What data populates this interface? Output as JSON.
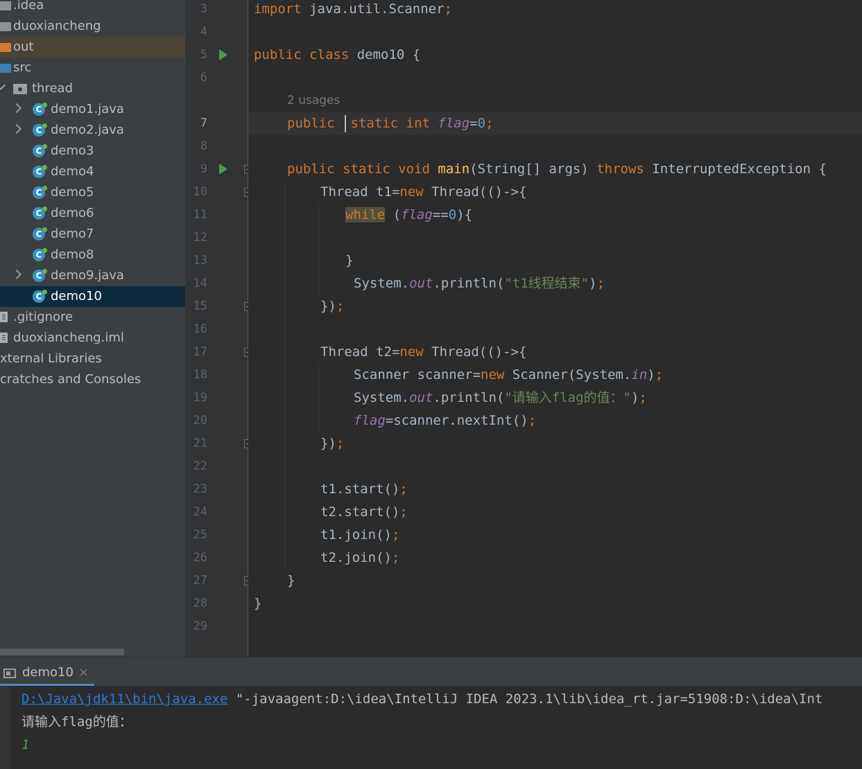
{
  "project_tree": {
    "items": [
      {
        "label": ".idea"
      },
      {
        "label": "duoxiancheng"
      },
      {
        "label": "out"
      },
      {
        "label": "src"
      },
      {
        "label": "thread"
      },
      {
        "label": "demo1.java"
      },
      {
        "label": "demo2.java"
      },
      {
        "label": "demo3"
      },
      {
        "label": "demo4"
      },
      {
        "label": "demo5"
      },
      {
        "label": "demo6"
      },
      {
        "label": "demo7"
      },
      {
        "label": "demo8"
      },
      {
        "label": "demo9.java"
      },
      {
        "label": "demo10"
      },
      {
        "label": ".gitignore"
      },
      {
        "label": "duoxiancheng.iml"
      },
      {
        "label": "xternal Libraries"
      },
      {
        "label": "cratches and Consoles"
      }
    ]
  },
  "editor": {
    "usage_hint": "2 usages",
    "line_numbers": [
      "3",
      "4",
      "5",
      "6",
      "7",
      "8",
      "9",
      "10",
      "11",
      "12",
      "13",
      "14",
      "15",
      "16",
      "17",
      "18",
      "19",
      "20",
      "21",
      "22",
      "23",
      "24",
      "25",
      "26",
      "27",
      "28",
      "29"
    ],
    "current_line": "7",
    "tokens": {
      "import": "import",
      "import_path": " java.util.Scanner",
      "semicolon": ";",
      "public": "public",
      "class": "class",
      "class_name": " demo10 {",
      "static": "static",
      "int": "int",
      "flag": "flag",
      "eq": "=",
      "zero": "0",
      "void": "void",
      "main": "main",
      "main_params": "(String[] args) ",
      "throws": "throws",
      "exception": " InterruptedException {",
      "thread_t1": "Thread t1=",
      "new": "new",
      "thread_lambda": " Thread(()->{",
      "while": "while",
      "while_open": " (",
      "eqeq": "==",
      "close_brace_paren": "){",
      "close_brace": "}",
      "system_out": "System.",
      "out": "out",
      "println_open": ".println(",
      "str_t1_end": "\"t1线程结束\"",
      "close_paren": ")",
      "lambda_end": "})",
      "thread_t2": "Thread t2=",
      "scanner_decl": "Scanner scanner=",
      "scanner_new": " Scanner(System.",
      "in": "in",
      "str_prompt": "\"请输入flag的值：\"",
      "scanner_next": "scanner.nextInt()",
      "t1_start": "t1.start()",
      "t2_start": "t2.start()",
      "t1_join": "t1.join()",
      "t2_join": "t2.join()"
    }
  },
  "run_panel": {
    "tab_label": "demo10",
    "close_symbol": "×",
    "console": {
      "java_path": "D:\\Java\\jdk11\\bin\\java.exe",
      "args": " \"-javaagent:D:\\idea\\IntelliJ IDEA 2023.1\\lib\\idea_rt.jar=51908:D:\\idea\\Int",
      "prompt": "请输入flag的值：",
      "input": "1"
    }
  },
  "colors": {
    "keyword": "#cc7832",
    "function": "#ffc66d",
    "field": "#9876aa",
    "number": "#6897bb",
    "string": "#6a8759",
    "default_text": "#a9b7c6",
    "link": "#287bde",
    "console_input": "#3ba73b"
  }
}
